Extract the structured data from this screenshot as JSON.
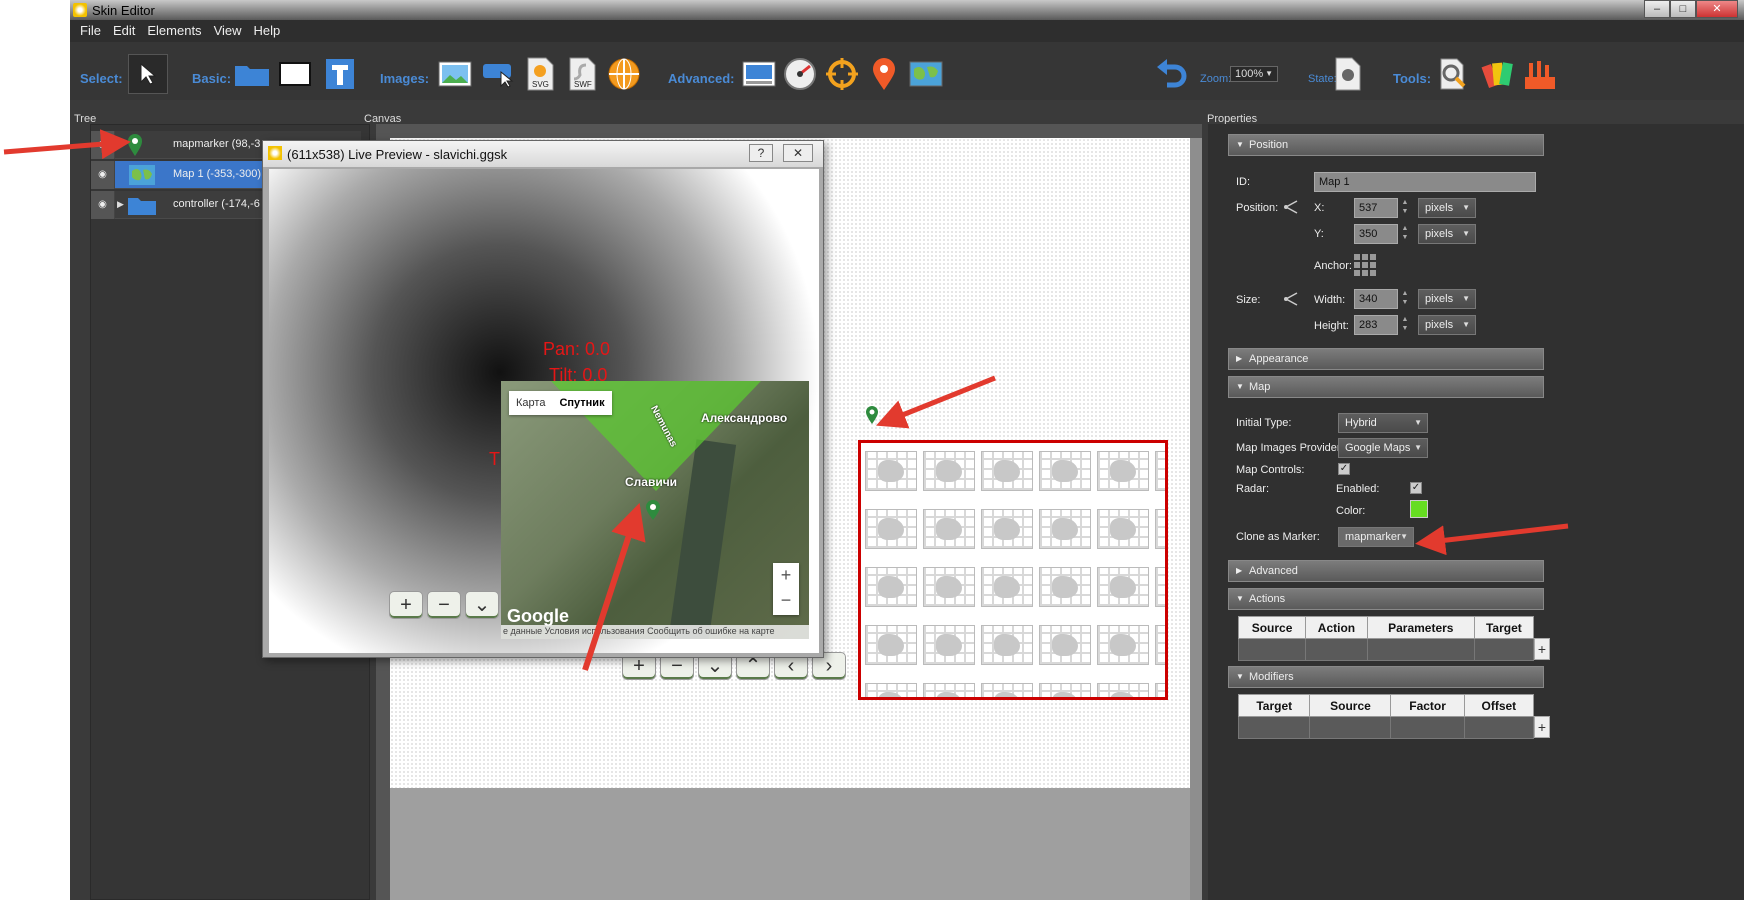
{
  "window": {
    "title": "Skin Editor",
    "buttons": {
      "minimize": "–",
      "maximize": "□",
      "close": "✕"
    }
  },
  "menu": [
    "File",
    "Edit",
    "Elements",
    "View",
    "Help"
  ],
  "toolbar": {
    "select_label": "Select:",
    "basic_label": "Basic:",
    "images_label": "Images:",
    "advanced_label": "Advanced:",
    "zoom_label": "Zoom:",
    "zoom_value": "100%",
    "state_label": "State:",
    "tools_label": "Tools:",
    "icons": {
      "svg": "SVG",
      "swf": "SWF"
    }
  },
  "panels": {
    "tree": "Tree",
    "canvas": "Canvas",
    "properties": "Properties"
  },
  "tree": [
    {
      "label": "mapmarker (98,-3"
    },
    {
      "label": "Map 1 (-353,-300)"
    },
    {
      "label": "controller (-174,-6"
    }
  ],
  "preview": {
    "title": "(611x538) Live Preview - slavichi.ggsk",
    "help": "?",
    "close": "✕",
    "pan": "Pan: 0.0",
    "tilt": "Tilt: 0.0",
    "partial": "Th",
    "map_tabs": [
      "Карта",
      "Спутник"
    ],
    "places": [
      "Александрово",
      "Славичи",
      "Nemunas"
    ],
    "zoom_plus": "+",
    "zoom_minus": "−",
    "google": "Google",
    "attribution": "е данные   Условия использования   Сообщить об ошибке на карте"
  },
  "canvas": {
    "nav_buttons": [
      "+",
      "−",
      "⌄",
      "⌃",
      "‹",
      "›"
    ]
  },
  "properties": {
    "position_section": "Position",
    "id_label": "ID:",
    "id_value": "Map 1",
    "position_label": "Position:",
    "x_label": "X:",
    "x_value": "537",
    "y_label": "Y:",
    "y_value": "350",
    "unit": "pixels",
    "anchor_label": "Anchor:",
    "size_label": "Size:",
    "width_label": "Width:",
    "width_value": "340",
    "height_label": "Height:",
    "height_value": "283",
    "appearance_section": "Appearance",
    "map_section": "Map",
    "initial_type_label": "Initial Type:",
    "initial_type_value": "Hybrid",
    "provider_label": "Map Images Provider:",
    "provider_value": "Google Maps",
    "controls_label": "Map Controls:",
    "radar_label": "Radar:",
    "enabled_label": "Enabled:",
    "color_label": "Color:",
    "radar_color": "#66dd22",
    "clone_label": "Clone as Marker:",
    "clone_value": "mapmarker",
    "advanced_section": "Advanced",
    "actions_section": "Actions",
    "actions_columns": [
      "Source",
      "Action",
      "Parameters",
      "Target"
    ],
    "modifiers_section": "Modifiers",
    "modifiers_columns": [
      "Target",
      "Source",
      "Factor",
      "Offset"
    ],
    "add": "+"
  },
  "colors": {
    "accent": "#4a8bd6",
    "annotation": "#e23a2e",
    "frame": "#cc0000"
  }
}
